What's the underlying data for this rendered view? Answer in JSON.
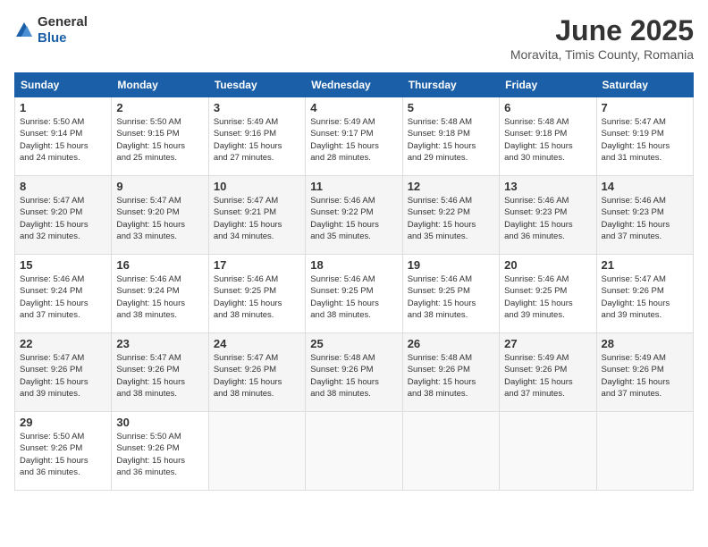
{
  "header": {
    "logo_general": "General",
    "logo_blue": "Blue",
    "month_title": "June 2025",
    "location": "Moravita, Timis County, Romania"
  },
  "weekdays": [
    "Sunday",
    "Monday",
    "Tuesday",
    "Wednesday",
    "Thursday",
    "Friday",
    "Saturday"
  ],
  "weeks": [
    [
      {
        "day": "1",
        "info": "Sunrise: 5:50 AM\nSunset: 9:14 PM\nDaylight: 15 hours\nand 24 minutes."
      },
      {
        "day": "2",
        "info": "Sunrise: 5:50 AM\nSunset: 9:15 PM\nDaylight: 15 hours\nand 25 minutes."
      },
      {
        "day": "3",
        "info": "Sunrise: 5:49 AM\nSunset: 9:16 PM\nDaylight: 15 hours\nand 27 minutes."
      },
      {
        "day": "4",
        "info": "Sunrise: 5:49 AM\nSunset: 9:17 PM\nDaylight: 15 hours\nand 28 minutes."
      },
      {
        "day": "5",
        "info": "Sunrise: 5:48 AM\nSunset: 9:18 PM\nDaylight: 15 hours\nand 29 minutes."
      },
      {
        "day": "6",
        "info": "Sunrise: 5:48 AM\nSunset: 9:18 PM\nDaylight: 15 hours\nand 30 minutes."
      },
      {
        "day": "7",
        "info": "Sunrise: 5:47 AM\nSunset: 9:19 PM\nDaylight: 15 hours\nand 31 minutes."
      }
    ],
    [
      {
        "day": "8",
        "info": "Sunrise: 5:47 AM\nSunset: 9:20 PM\nDaylight: 15 hours\nand 32 minutes."
      },
      {
        "day": "9",
        "info": "Sunrise: 5:47 AM\nSunset: 9:20 PM\nDaylight: 15 hours\nand 33 minutes."
      },
      {
        "day": "10",
        "info": "Sunrise: 5:47 AM\nSunset: 9:21 PM\nDaylight: 15 hours\nand 34 minutes."
      },
      {
        "day": "11",
        "info": "Sunrise: 5:46 AM\nSunset: 9:22 PM\nDaylight: 15 hours\nand 35 minutes."
      },
      {
        "day": "12",
        "info": "Sunrise: 5:46 AM\nSunset: 9:22 PM\nDaylight: 15 hours\nand 35 minutes."
      },
      {
        "day": "13",
        "info": "Sunrise: 5:46 AM\nSunset: 9:23 PM\nDaylight: 15 hours\nand 36 minutes."
      },
      {
        "day": "14",
        "info": "Sunrise: 5:46 AM\nSunset: 9:23 PM\nDaylight: 15 hours\nand 37 minutes."
      }
    ],
    [
      {
        "day": "15",
        "info": "Sunrise: 5:46 AM\nSunset: 9:24 PM\nDaylight: 15 hours\nand 37 minutes."
      },
      {
        "day": "16",
        "info": "Sunrise: 5:46 AM\nSunset: 9:24 PM\nDaylight: 15 hours\nand 38 minutes."
      },
      {
        "day": "17",
        "info": "Sunrise: 5:46 AM\nSunset: 9:25 PM\nDaylight: 15 hours\nand 38 minutes."
      },
      {
        "day": "18",
        "info": "Sunrise: 5:46 AM\nSunset: 9:25 PM\nDaylight: 15 hours\nand 38 minutes."
      },
      {
        "day": "19",
        "info": "Sunrise: 5:46 AM\nSunset: 9:25 PM\nDaylight: 15 hours\nand 38 minutes."
      },
      {
        "day": "20",
        "info": "Sunrise: 5:46 AM\nSunset: 9:25 PM\nDaylight: 15 hours\nand 39 minutes."
      },
      {
        "day": "21",
        "info": "Sunrise: 5:47 AM\nSunset: 9:26 PM\nDaylight: 15 hours\nand 39 minutes."
      }
    ],
    [
      {
        "day": "22",
        "info": "Sunrise: 5:47 AM\nSunset: 9:26 PM\nDaylight: 15 hours\nand 39 minutes."
      },
      {
        "day": "23",
        "info": "Sunrise: 5:47 AM\nSunset: 9:26 PM\nDaylight: 15 hours\nand 38 minutes."
      },
      {
        "day": "24",
        "info": "Sunrise: 5:47 AM\nSunset: 9:26 PM\nDaylight: 15 hours\nand 38 minutes."
      },
      {
        "day": "25",
        "info": "Sunrise: 5:48 AM\nSunset: 9:26 PM\nDaylight: 15 hours\nand 38 minutes."
      },
      {
        "day": "26",
        "info": "Sunrise: 5:48 AM\nSunset: 9:26 PM\nDaylight: 15 hours\nand 38 minutes."
      },
      {
        "day": "27",
        "info": "Sunrise: 5:49 AM\nSunset: 9:26 PM\nDaylight: 15 hours\nand 37 minutes."
      },
      {
        "day": "28",
        "info": "Sunrise: 5:49 AM\nSunset: 9:26 PM\nDaylight: 15 hours\nand 37 minutes."
      }
    ],
    [
      {
        "day": "29",
        "info": "Sunrise: 5:50 AM\nSunset: 9:26 PM\nDaylight: 15 hours\nand 36 minutes."
      },
      {
        "day": "30",
        "info": "Sunrise: 5:50 AM\nSunset: 9:26 PM\nDaylight: 15 hours\nand 36 minutes."
      },
      {
        "day": "",
        "info": ""
      },
      {
        "day": "",
        "info": ""
      },
      {
        "day": "",
        "info": ""
      },
      {
        "day": "",
        "info": ""
      },
      {
        "day": "",
        "info": ""
      }
    ]
  ]
}
